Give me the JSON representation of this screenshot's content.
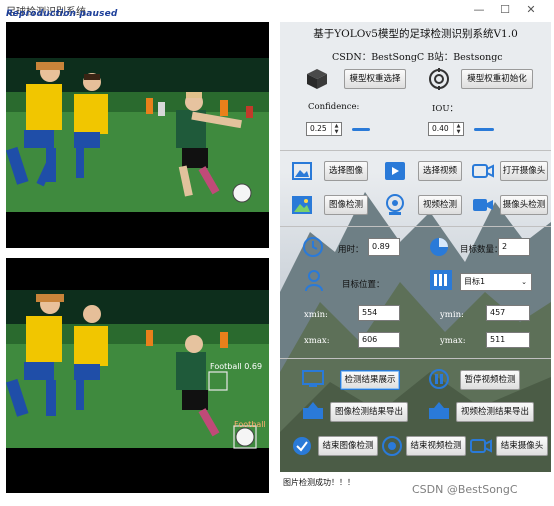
{
  "window": {
    "title": "足球检测识别系统",
    "overlay_text": "Reproduction paused",
    "controls": [
      "—",
      "☐",
      "✕"
    ]
  },
  "header": {
    "title": "基于YOLOv5模型的足球检测识别系统V1.0",
    "subtitle": "CSDN：BestSongC   B站：Bestsongc"
  },
  "model": {
    "select_label": "模型权重选择",
    "init_label": "模型权重初始化",
    "confidence_label": "Confidence:",
    "confidence_value": "0.25",
    "iou_label": "IOU：",
    "iou_value": "0.40"
  },
  "actions": {
    "select_image": "选择图像",
    "select_video": "选择视频",
    "open_camera": "打开摄像头",
    "image_detect": "图像检测",
    "video_detect": "视频检测",
    "camera_detect": "摄像头检测"
  },
  "info": {
    "time_label": "用时：",
    "time_value": "0.89",
    "count_label": "目标数量：",
    "count_value": "2",
    "position_label": "目标位置：",
    "target_select": "目标1",
    "xmin_label": "xmin:",
    "xmin_value": "554",
    "ymin_label": "ymin:",
    "ymin_value": "457",
    "xmax_label": "xmax:",
    "xmax_value": "606",
    "ymax_label": "ymax:",
    "ymax_value": "511"
  },
  "results": {
    "show_results": "检测结果展示",
    "pause_video": "暂停视频检测",
    "export_image": "图像检测结果导出",
    "export_video": "视频检测结果导出",
    "end_image": "结束图像检测",
    "end_video": "结束视频检测",
    "end_camera": "结束摄像头"
  },
  "detections": [
    {
      "label": "Football",
      "score": "0.69"
    },
    {
      "label": "Football",
      "score": ""
    }
  ],
  "status_text": "图片检测成功！！！",
  "watermark": "CSDN @BestSongC"
}
